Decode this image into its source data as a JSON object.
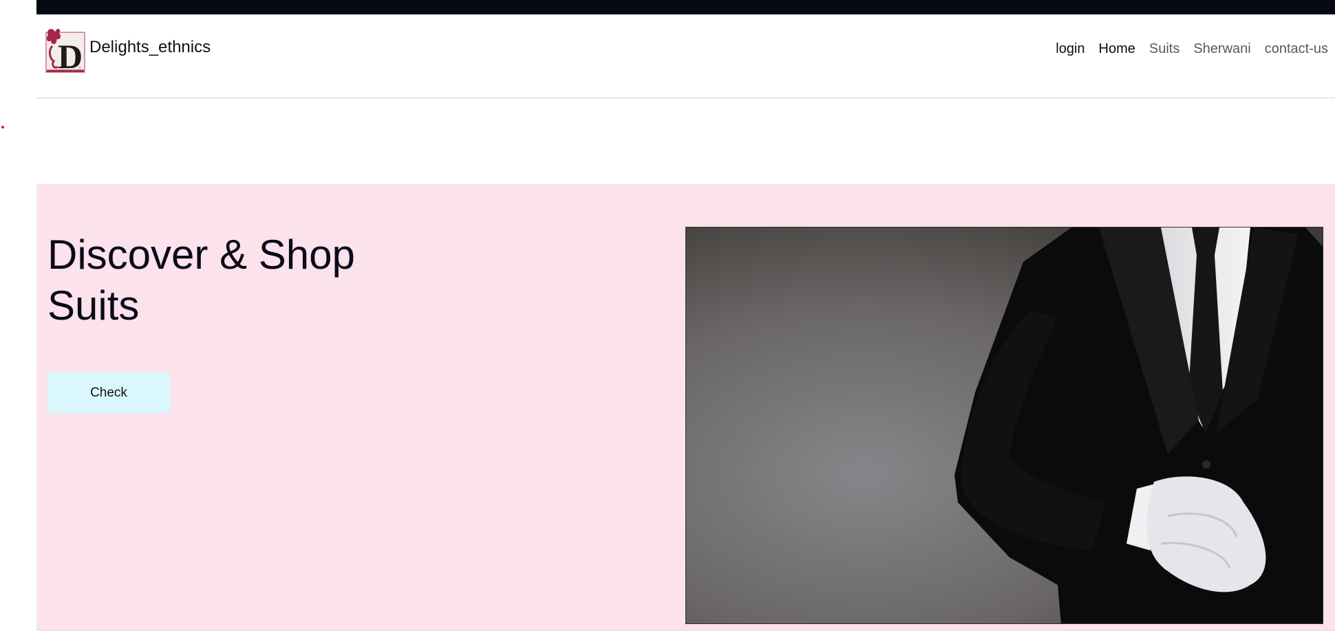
{
  "brand": {
    "name": "Delights_ethnics",
    "logo_icon": "ornate-d-monogram-logo",
    "logo_letter": "D"
  },
  "nav": {
    "items": [
      {
        "label": "login"
      },
      {
        "label": "Home"
      },
      {
        "label": "Suits"
      },
      {
        "label": "Sherwani"
      },
      {
        "label": "contact-us"
      }
    ]
  },
  "hero": {
    "title": "Discover & Shop Suits",
    "button_label": "Check",
    "image_icon": "man-in-black-suit-white-gloves-photo"
  },
  "colors": {
    "top_bar": "#050913",
    "hero_background": "#fbe2eb",
    "button_background": "#d9f7fd"
  }
}
